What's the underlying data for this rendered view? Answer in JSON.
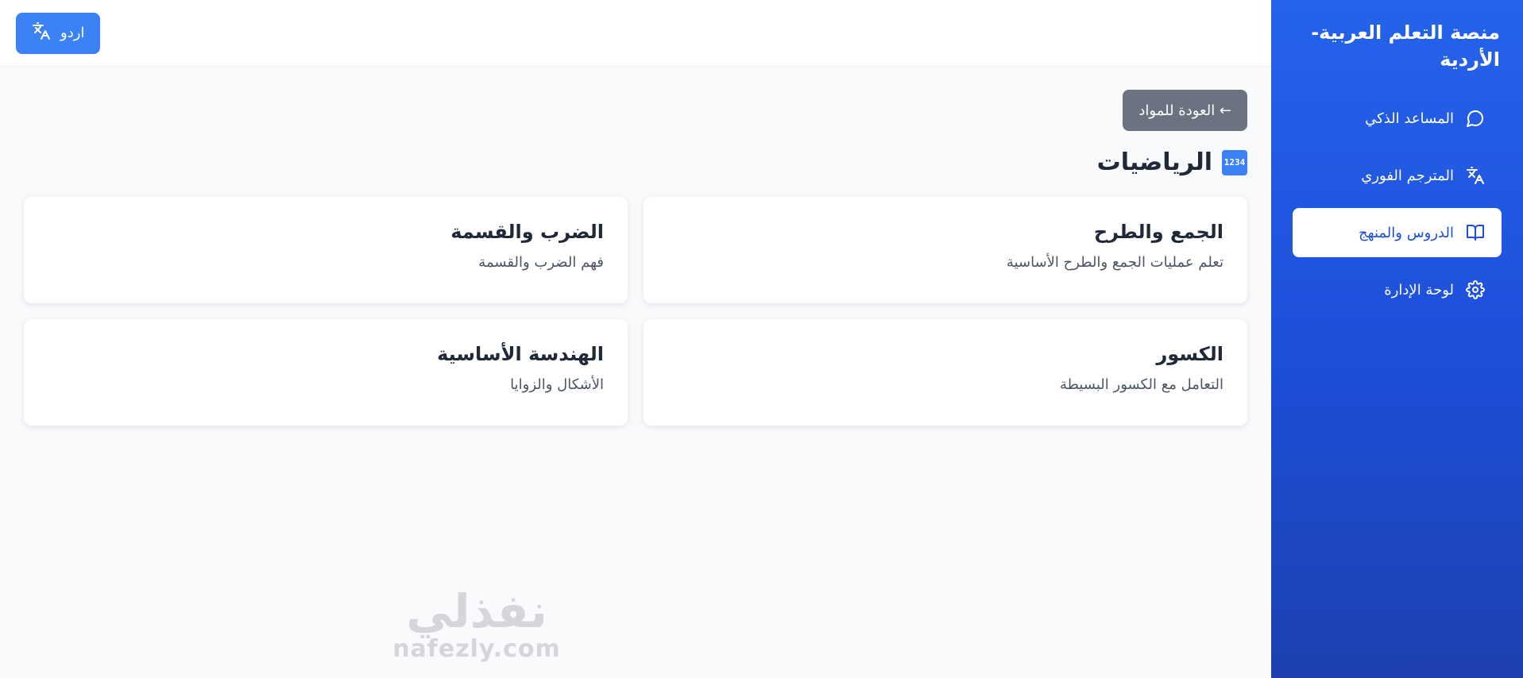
{
  "sidebar": {
    "title": "منصة التعلم العربية-الأردية",
    "items": [
      {
        "label": "المساعد الذكي",
        "icon": "chat-bubble-icon"
      },
      {
        "label": "المترجم الفوري",
        "icon": "translate-icon"
      },
      {
        "label": "الدروس والمنهج",
        "icon": "book-open-icon",
        "active": true
      },
      {
        "label": "لوحة الإدارة",
        "icon": "gear-icon"
      }
    ]
  },
  "header": {
    "language_button": {
      "label": "اردو",
      "icon": "translate-icon"
    }
  },
  "main": {
    "back_label": "← العودة للمواد",
    "subject_title": "الرياضيات",
    "subject_emoji_label": "1234",
    "lessons": [
      {
        "title": "الجمع والطرح",
        "description": "تعلم عمليات الجمع والطرح الأساسية"
      },
      {
        "title": "الضرب والقسمة",
        "description": "فهم الضرب والقسمة"
      },
      {
        "title": "الكسور",
        "description": "التعامل مع الكسور البسيطة"
      },
      {
        "title": "الهندسة الأساسية",
        "description": "الأشكال والزوايا"
      }
    ]
  },
  "watermark": {
    "arabic": "نفذلي",
    "latin": "nafezly.com"
  },
  "colors": {
    "sidebar_gradient_top": "#2563eb",
    "sidebar_gradient_bottom": "#1e40af",
    "primary": "#3b82f6",
    "secondary_button": "#6b7280",
    "background": "#f8fafc"
  }
}
